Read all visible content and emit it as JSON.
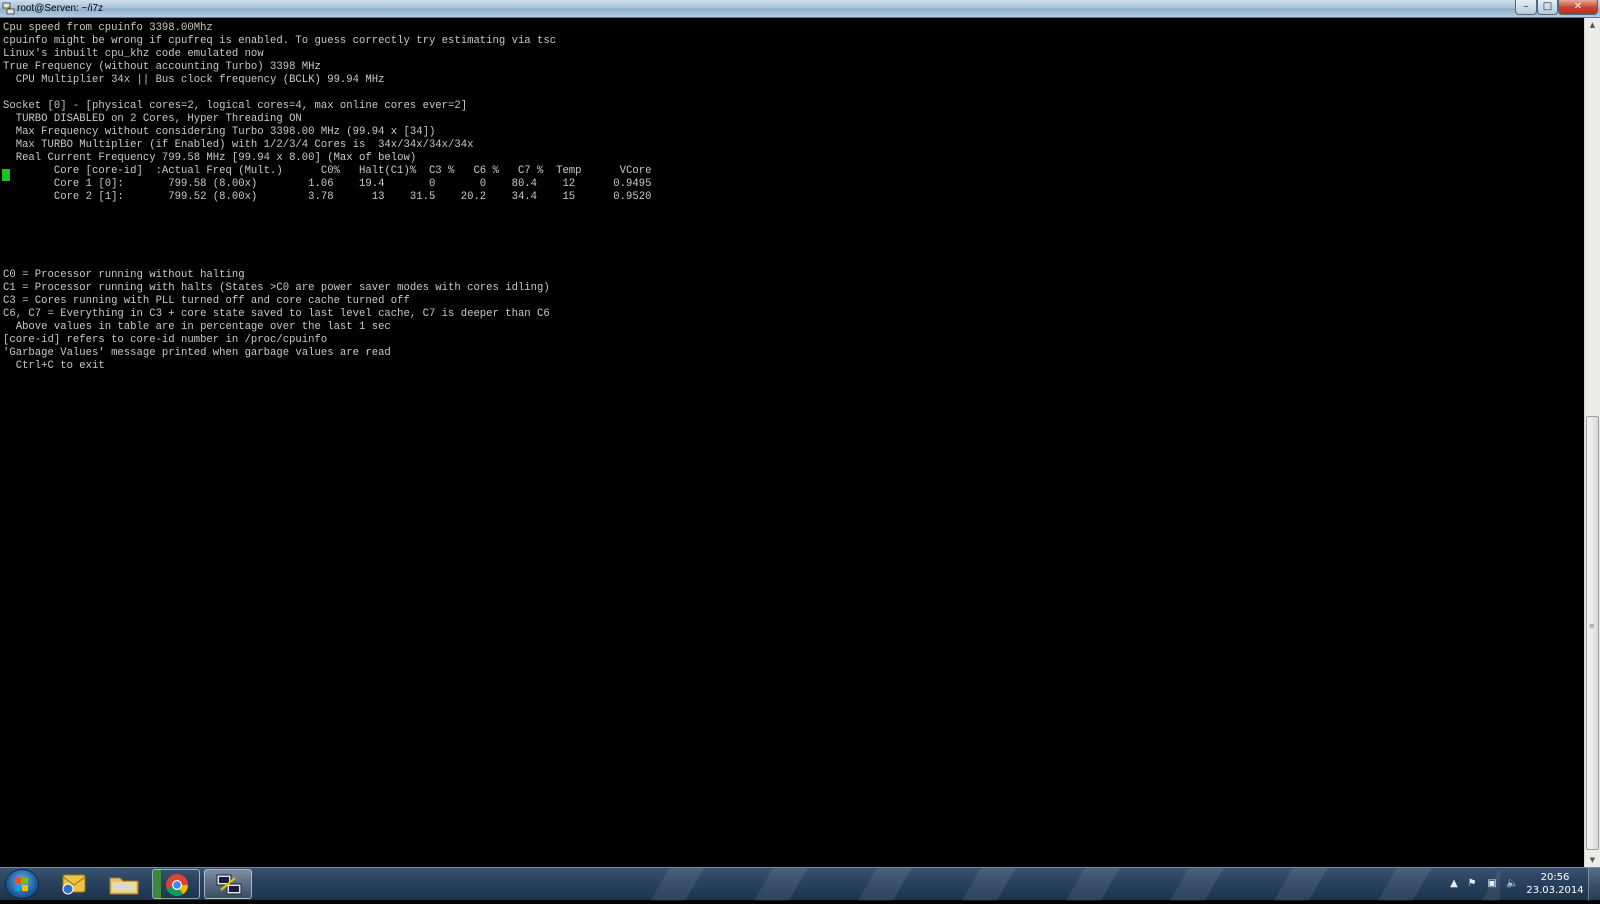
{
  "window": {
    "title": "root@Serven: ~/i7z",
    "minimize_glyph": "–",
    "maximize_glyph": "□",
    "close_glyph": "✕"
  },
  "terminal": {
    "lines": [
      "Cpu speed from cpuinfo 3398.00Mhz",
      "cpuinfo might be wrong if cpufreq is enabled. To guess correctly try estimating via tsc",
      "Linux's inbuilt cpu_khz code emulated now",
      "True Frequency (without accounting Turbo) 3398 MHz",
      "  CPU Multiplier 34x || Bus clock frequency (BCLK) 99.94 MHz",
      "",
      "Socket [0] - [physical cores=2, logical cores=4, max online cores ever=2]",
      "  TURBO DISABLED on 2 Cores, Hyper Threading ON",
      "  Max Frequency without considering Turbo 3398.00 MHz (99.94 x [34])",
      "  Max TURBO Multiplier (if Enabled) with 1/2/3/4 Cores is  34x/34x/34x/34x",
      "  Real Current Frequency 799.58 MHz [99.94 x 8.00] (Max of below)",
      "        Core [core-id]  :Actual Freq (Mult.)      C0%   Halt(C1)%  C3 %   C6 %   C7 %  Temp      VCore",
      "        Core 1 [0]:       799.58 (8.00x)        1.06    19.4       0       0    80.4    12      0.9495",
      "        Core 2 [1]:       799.52 (8.00x)        3.78      13    31.5    20.2    34.4    15      0.9520",
      "",
      "",
      "",
      "",
      "",
      "C0 = Processor running without halting",
      "C1 = Processor running with halts (States >C0 are power saver modes with cores idling)",
      "C3 = Cores running with PLL turned off and core cache turned off",
      "C6, C7 = Everything in C3 + core state saved to last level cache, C7 is deeper than C6",
      "  Above values in table are in percentage over the last 1 sec",
      "[core-id] refers to core-id number in /proc/cpuinfo",
      "'Garbage Values' message printed when garbage values are read",
      "  Ctrl+C to exit"
    ]
  },
  "scrollbar": {
    "up_glyph": "▲",
    "down_glyph": "▼",
    "grip_glyph": "≡"
  },
  "taskbar": {
    "items": [
      {
        "name": "outlook-icon"
      },
      {
        "name": "windows-explorer-icon"
      },
      {
        "name": "chrome-icon"
      },
      {
        "name": "putty-icon"
      }
    ],
    "tray": {
      "show_hidden_glyph": "▲",
      "flag_glyph": "⚑",
      "network_glyph": "▣",
      "volume_glyph": "🔈"
    },
    "clock": {
      "time": "20:56",
      "date": "23.03.2014"
    }
  },
  "colors": {
    "terminal_bg": "#000000",
    "terminal_fg": "#c9c9c9",
    "cursor": "#1ec21e",
    "close_button": "#c7402a"
  }
}
